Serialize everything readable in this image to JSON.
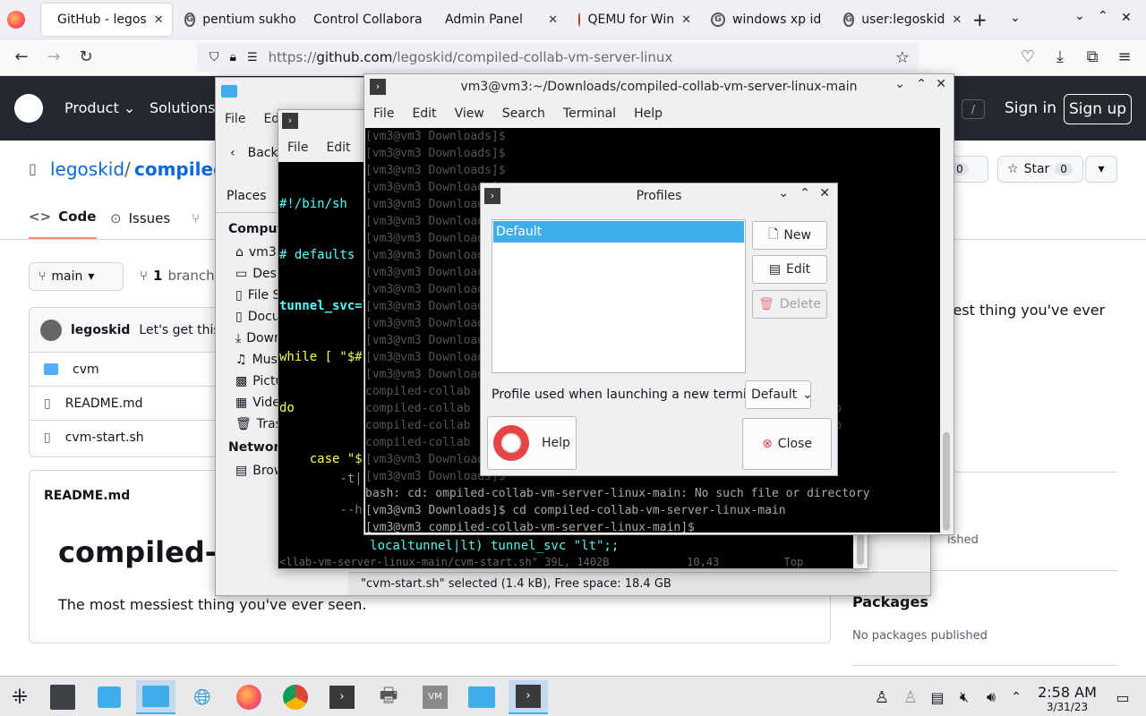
{
  "browser": {
    "tabs": [
      {
        "label": "GitHub - legos",
        "active": true
      },
      {
        "label": "pentium sukho"
      },
      {
        "label": "Control Collabora"
      },
      {
        "label": "Admin Panel"
      },
      {
        "label": "QEMU for Win"
      },
      {
        "label": "windows xp id"
      },
      {
        "label": "user:legoskid"
      }
    ],
    "url_prefix": "https://",
    "url_host": "github.com",
    "url_path": "/legoskid/compiled-collab-vm-server-linux"
  },
  "github": {
    "nav": {
      "product": "Product",
      "solutions": "Solutions",
      "signin": "Sign in",
      "signup": "Sign up",
      "slash": "/"
    },
    "owner": "legoskid",
    "sep": "/",
    "repo": "compiled",
    "tabs": {
      "code": "Code",
      "issues": "Issues"
    },
    "fork_count": "0",
    "star_label": "Star",
    "star_count": "0",
    "branch_btn": "main",
    "branch_count": "1",
    "branch_label": "branch",
    "commit_author": "legoskid",
    "commit_msg": "Let's get this in",
    "files": [
      "cvm",
      "README.md",
      "cvm-start.sh"
    ],
    "readme_header": "README.md",
    "readme_title": "compiled-c",
    "readme_desc": "The most messiest thing you've ever seen.",
    "about_fragment": "iest thing you've ever",
    "releases_fragment": "ished",
    "packages_title": "Packages",
    "packages_empty": "No packages published"
  },
  "filemanager": {
    "menu": [
      "File",
      "Edi"
    ],
    "back": "Back",
    "places_title": "Places",
    "computer": "Compute",
    "places": [
      "vm3",
      "Desk",
      "File S",
      "Docu",
      "Down",
      "Music",
      "Pictu",
      "Video",
      "Trash"
    ],
    "network": "Network",
    "browse": "Brow",
    "status": "\"cvm-start.sh\" selected (1.4 kB), Free space: 18.4 GB"
  },
  "editor": {
    "menu": [
      "File",
      "Edit"
    ],
    "lines": [
      "#!/bin/sh",
      "# defaults",
      "tunnel_svc=l",
      "while [ \"$#\"",
      "do",
      "    case \"$1",
      "        --he"
    ],
    "bottom1": "            localtunnel|lt) tunnel_svc \"lt\";;",
    "bottom2": "<llab-vm-server-linux-main/cvm-start.sh\" 39L, 1402B            10,43          Top",
    "side_t": "        -t|-"
  },
  "terminal": {
    "title": "vm3@vm3:~/Downloads/compiled-collab-vm-server-linux-main",
    "menu": [
      "File",
      "Edit",
      "View",
      "Search",
      "Terminal",
      "Help"
    ],
    "lines": [
      "[vm3@vm3 Downloads]$",
      "[vm3@vm3 Downloads]$",
      "[vm3@vm3 Downloads]$",
      "[vm3@vm3 Downloads]$",
      "[vm3@vm3 Downloads]$",
      "[vm3@vm3 Downloads]$",
      "[vm3@vm3 Downloads]$",
      "[vm3@vm3 Downloads]$",
      "[vm3@vm3 Downloads]$",
      "[vm3@vm3 Downloads]$",
      "[vm3@vm3 Downloads]$",
      "[vm3@vm3 Downloads]$",
      "[vm3@vm3 Downloads]$",
      "[vm3@vm3 Downloads]$",
      "[vm3@vm3 Downloads]$",
      "compiled-collab                                              ase",
      "compiled-collab                                              -r1.iso",
      "compiled-collab                                              -r1.iso",
      "compiled-collab",
      "[vm3@vm3 Downloads]$",
      "[vm3@vm3 Downloads]$",
      "bash: cd: ompiled-collab-vm-server-linux-main: No such file or directory",
      "[vm3@vm3 Downloads]$ cd compiled-collab-vm-server-linux-main",
      "[vm3@vm3 compiled-collab-vm-server-linux-main]$ "
    ]
  },
  "profiles": {
    "title": "Profiles",
    "list": [
      "Default"
    ],
    "new": "New",
    "edit": "Edit",
    "delete": "Delete",
    "launch_label": "Profile used when launching a new terminal:",
    "launch_value": "Default",
    "help": "Help",
    "close": "Close"
  },
  "taskbar": {
    "time": "2:58 AM",
    "date": "3/31/23"
  },
  "colors": {
    "gh_dark": "#24292f",
    "kde_blue": "#3daee9",
    "selection": "#3daee9",
    "term_cyan": "#55ffff",
    "term_yellow": "#ffff55"
  }
}
